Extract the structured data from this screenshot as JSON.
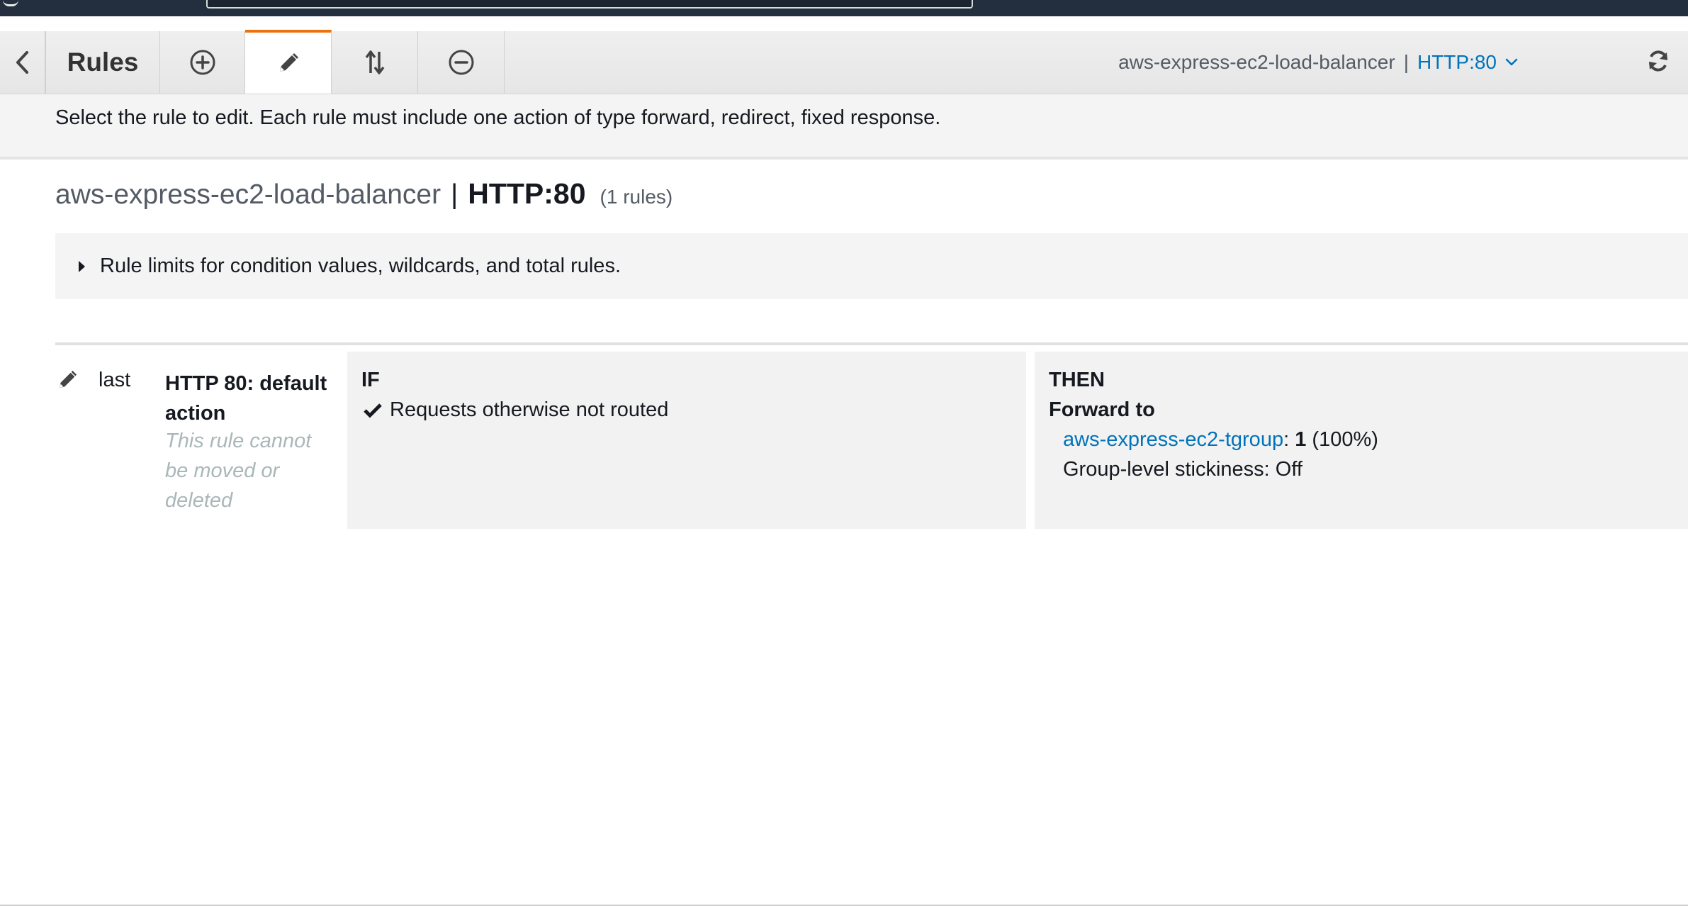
{
  "toolbar": {
    "title": "Rules",
    "icons": {
      "back": "chevron-left-icon",
      "add": "plus-circle-icon",
      "edit": "pencil-icon",
      "reorder": "up-down-arrows-icon",
      "delete": "minus-circle-icon",
      "refresh": "refresh-icon"
    },
    "active_tab": "edit",
    "active_color": "#ec7211"
  },
  "selector": {
    "load_balancer": "aws-express-ec2-load-balancer",
    "separator": "|",
    "listener": "HTTP:80"
  },
  "instructions": "Select the rule to edit. Each rule must include one action of type forward, redirect, fixed response.",
  "heading": {
    "load_balancer": "aws-express-ec2-load-balancer",
    "separator": "|",
    "listener": "HTTP:80",
    "count": "(1 rules)"
  },
  "limits": {
    "label": "Rule limits for condition values, wildcards, and total rules."
  },
  "rule": {
    "priority": "last",
    "name": "HTTP 80: default action",
    "note": "This rule cannot be moved or deleted",
    "if_label": "IF",
    "condition": "Requests otherwise not routed",
    "then_label": "THEN",
    "action": "Forward to",
    "target_group": "aws-express-ec2-tgroup",
    "target_separator": ":",
    "weight": "1",
    "weight_percent": "(100%)",
    "stickiness": "Group-level stickiness: Off"
  },
  "colors": {
    "link": "#0073bb",
    "nav": "#232f3e"
  }
}
